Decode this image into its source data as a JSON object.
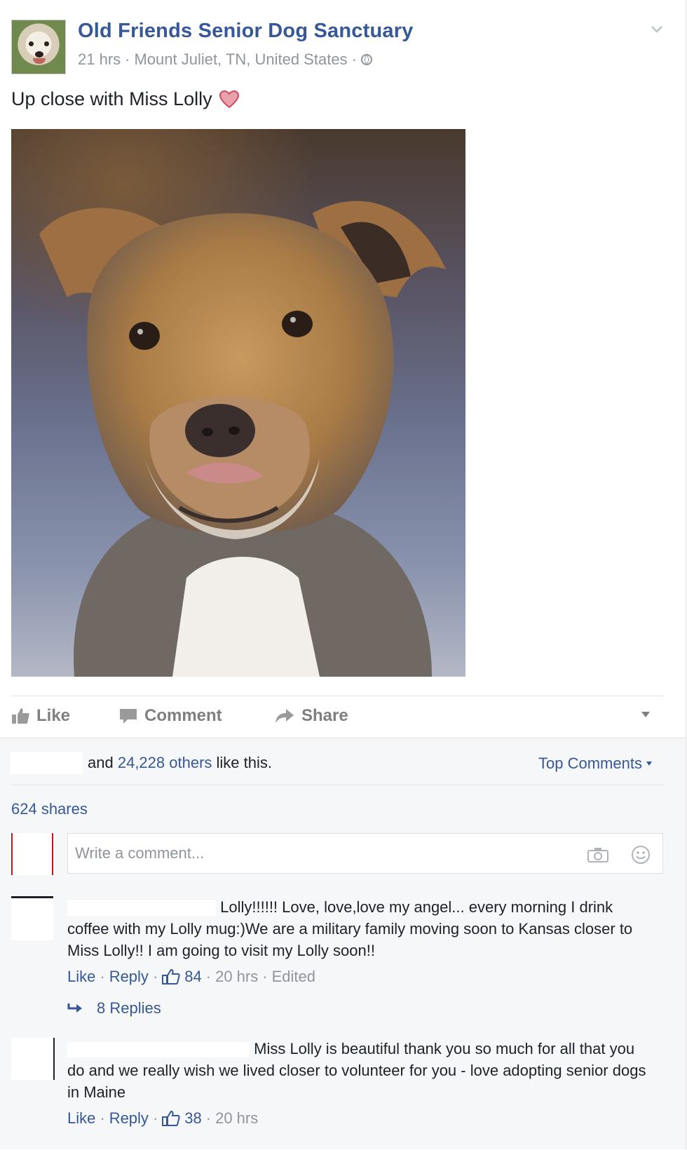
{
  "post": {
    "page_name": "Old Friends Senior Dog Sanctuary",
    "time": "21 hrs",
    "location": "Mount Juliet, TN, United States",
    "sep": "·",
    "text": "Up close with Miss Lolly",
    "photo_alt": "Up close photo of Miss Lolly"
  },
  "actions": {
    "like": "Like",
    "comment": "Comment",
    "share": "Share"
  },
  "engagement": {
    "likes_prefix": "and",
    "likes_count_link": "24,228 others",
    "likes_suffix": "like this.",
    "top_comments": "Top Comments",
    "shares": "624 shares"
  },
  "comment_input": {
    "placeholder": "Write a comment..."
  },
  "comments": [
    {
      "text": "Lolly!!!!!! Love, love,love my angel... every morning I drink coffee with my Lolly mug:)We are a military family moving soon to Kansas closer to Miss Lolly!! I am going to visit my Lolly soon!!",
      "like": "Like",
      "reply": "Reply",
      "likes": "84",
      "time": "20 hrs",
      "edited": "Edited",
      "replies": "8 Replies"
    },
    {
      "text": "Miss Lolly is beautiful thank you so much for all that you do and we really wish we lived closer to volunteer for you - love adopting senior dogs in Maine",
      "like": "Like",
      "reply": "Reply",
      "likes": "38",
      "time": "20 hrs"
    }
  ],
  "colors": {
    "link": "#365899",
    "meta": "#90949c",
    "text": "#1d2129",
    "heart": "#e05b6f"
  },
  "icons": [
    "globe-icon",
    "chevron-down-icon",
    "heart-icon",
    "thumbs-up-icon",
    "comment-icon",
    "share-arrow-icon",
    "camera-icon",
    "smile-icon",
    "reply-arrow-icon"
  ]
}
